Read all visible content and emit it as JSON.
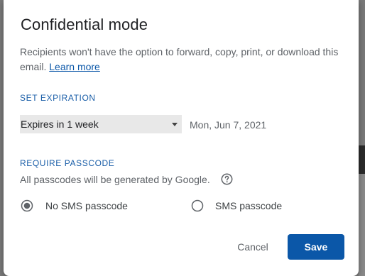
{
  "dialog": {
    "title": "Confidential mode",
    "description_text": "Recipients won't have the option to forward, copy, print, or download this email.",
    "learn_more_label": "Learn more"
  },
  "expiration": {
    "section_label": "SET EXPIRATION",
    "selected_option": "Expires in 1 week",
    "expiry_date": "Mon, Jun 7, 2021"
  },
  "passcode": {
    "section_label": "REQUIRE PASSCODE",
    "note": "All passcodes will be generated by Google.",
    "options": [
      {
        "label": "No SMS passcode",
        "selected": true
      },
      {
        "label": "SMS passcode",
        "selected": false
      }
    ]
  },
  "actions": {
    "cancel_label": "Cancel",
    "save_label": "Save"
  },
  "colors": {
    "accent": "#0b57a8",
    "section_label": "#1a5ea8",
    "select_background": "#e8e8e8"
  },
  "icons": {
    "help": "help-circle-icon",
    "dropdown": "caret-down-icon"
  }
}
